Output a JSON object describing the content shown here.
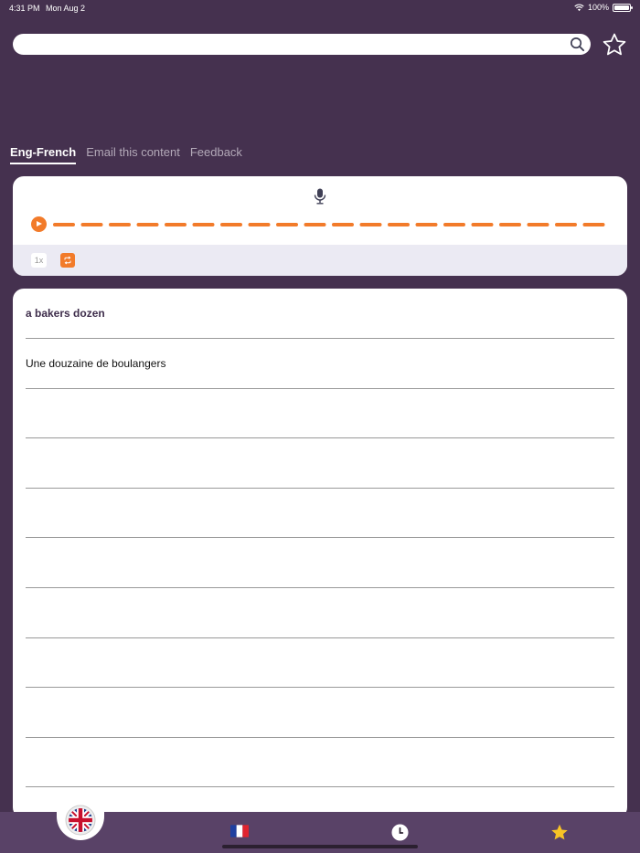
{
  "status": {
    "time": "4:31 PM",
    "date": "Mon Aug 2",
    "battery": "100%"
  },
  "search": {
    "value": "",
    "placeholder": ""
  },
  "tabs": [
    {
      "label": "Eng-French",
      "active": true
    },
    {
      "label": "Email this content",
      "active": false
    },
    {
      "label": "Feedback",
      "active": false
    }
  ],
  "player": {
    "speed_label": "1x",
    "progress": 0
  },
  "content": {
    "lines": [
      {
        "text": "a bakers dozen",
        "bold": true
      },
      {
        "text": "Une douzaine de boulangers",
        "bold": false
      },
      {
        "text": "",
        "bold": false
      },
      {
        "text": "",
        "bold": false
      },
      {
        "text": "",
        "bold": false
      },
      {
        "text": "",
        "bold": false
      },
      {
        "text": "",
        "bold": false
      },
      {
        "text": "",
        "bold": false
      },
      {
        "text": "",
        "bold": false
      },
      {
        "text": "",
        "bold": false
      }
    ]
  },
  "colors": {
    "background": "#45314f",
    "accent": "#f27b2a",
    "bottom_bar": "#594267",
    "title": "#3f2e4c"
  },
  "icons": {
    "search": "search-icon",
    "favorite": "star-outline-icon",
    "mic": "microphone-icon",
    "play": "play-icon",
    "repeat": "repeat-icon",
    "english": "uk-flag-icon",
    "french": "france-flag-icon",
    "history": "clock-icon",
    "favorites": "star-filled-icon"
  }
}
